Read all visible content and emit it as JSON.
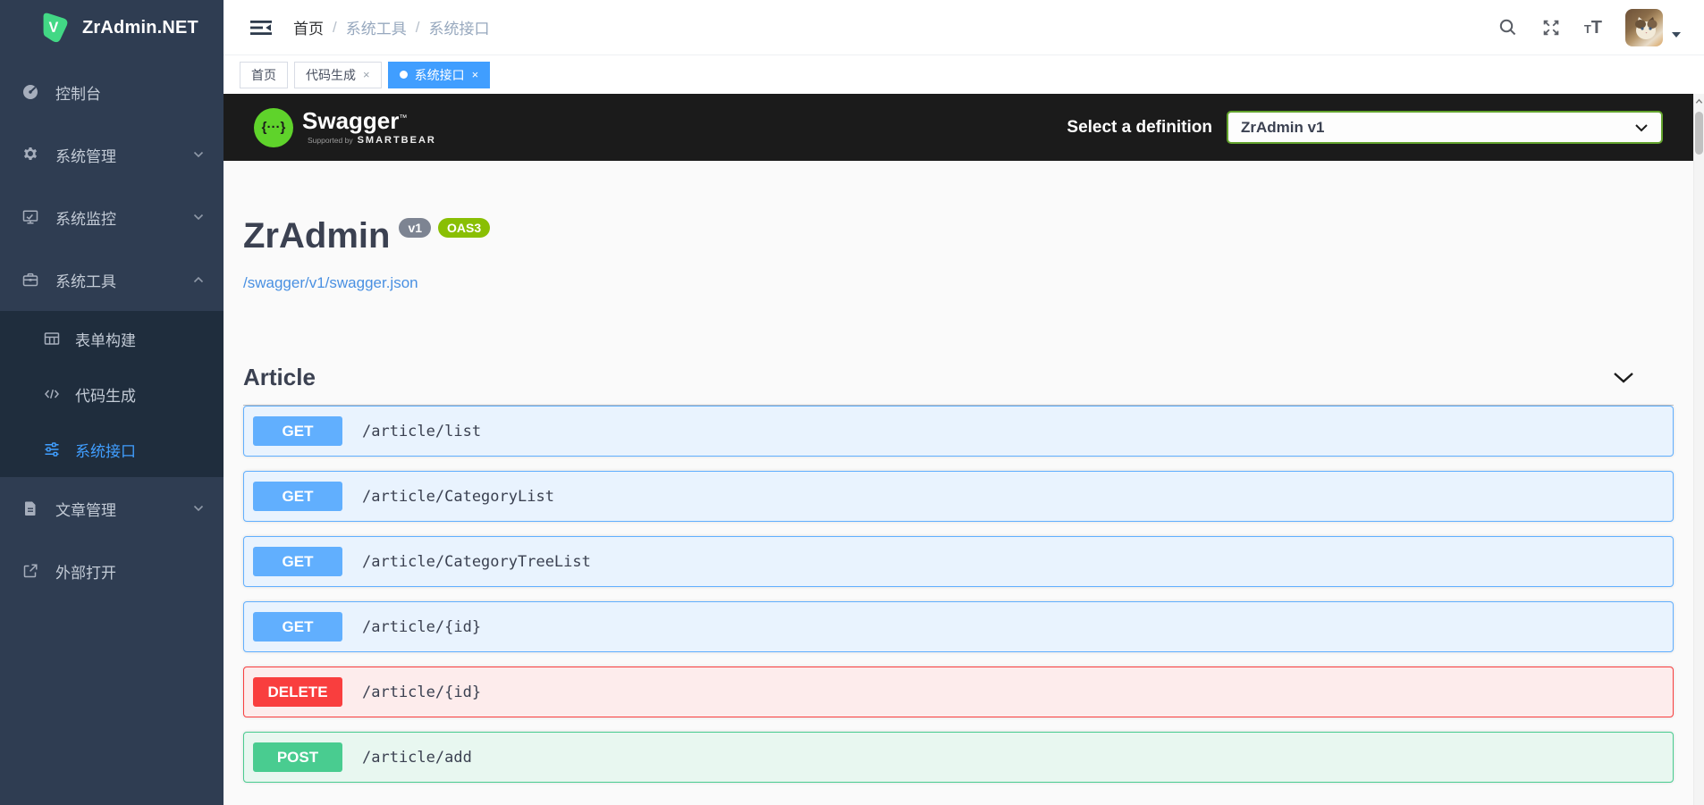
{
  "app": {
    "logo_text": "ZrAdmin.NET"
  },
  "sidebar": {
    "items": [
      {
        "label": "控制台"
      },
      {
        "label": "系统管理"
      },
      {
        "label": "系统监控"
      },
      {
        "label": "系统工具"
      },
      {
        "label": "文章管理"
      },
      {
        "label": "外部打开"
      }
    ],
    "submenu": [
      {
        "label": "表单构建"
      },
      {
        "label": "代码生成"
      },
      {
        "label": "系统接口"
      }
    ]
  },
  "breadcrumb": {
    "home": "首页",
    "separator": "/",
    "level2": "系统工具",
    "level3": "系统接口"
  },
  "tabs": [
    {
      "label": "首页"
    },
    {
      "label": "代码生成",
      "close": "×"
    },
    {
      "label": "系统接口",
      "close": "×"
    }
  ],
  "header_icons": {
    "font_small": "T",
    "font_large": "T"
  },
  "swagger": {
    "topbar": {
      "logo_text": "Swagger",
      "logo_tm": "™",
      "logo_braces": "{···}",
      "supported_by": "Supported by",
      "smartbear": "SMARTBEAR",
      "select_label": "Select a definition",
      "selected_definition": "ZrAdmin v1"
    },
    "info": {
      "title": "ZrAdmin",
      "version_badge": "v1",
      "oas_badge": "OAS3",
      "spec_link": "/swagger/v1/swagger.json"
    },
    "section": {
      "title": "Article"
    },
    "endpoints": [
      {
        "method": "GET",
        "path": "/article/list"
      },
      {
        "method": "GET",
        "path": "/article/CategoryList"
      },
      {
        "method": "GET",
        "path": "/article/CategoryTreeList"
      },
      {
        "method": "GET",
        "path": "/article/{id}"
      },
      {
        "method": "DELETE",
        "path": "/article/{id}"
      },
      {
        "method": "POST",
        "path": "/article/add"
      }
    ]
  },
  "colors": {
    "accent": "#409eff",
    "get": "#61affe",
    "post": "#49cc90",
    "delete": "#f93e3e",
    "oas_badge_bg": "#89bf04",
    "version_badge_bg": "#7d8492",
    "sidebar_bg": "#2f3d52",
    "submenu_bg": "#1f2d3d",
    "swagger_topbar_bg": "#1b1b1b",
    "link": "#4990e2"
  }
}
